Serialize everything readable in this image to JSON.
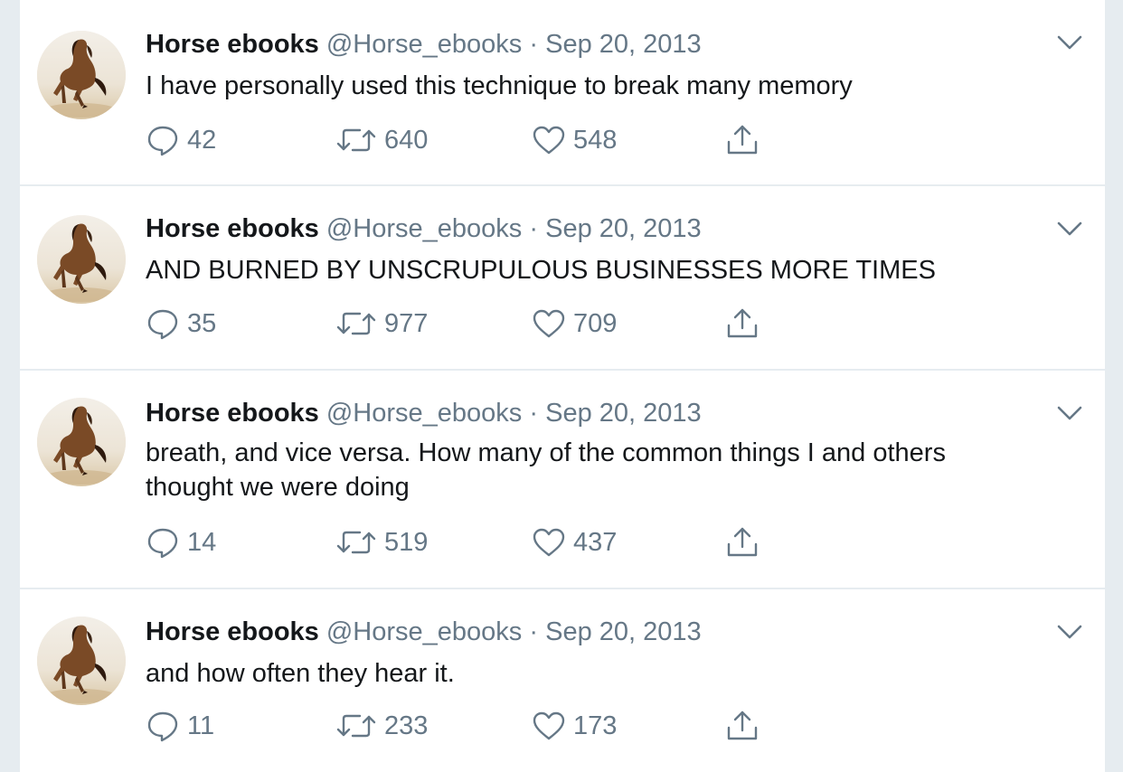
{
  "colors": {
    "page_background": "#e6ecf0",
    "card_background": "#ffffff",
    "primary_text": "#14171a",
    "secondary_text": "#657786"
  },
  "icons": {
    "reply": "speech-bubble-icon",
    "retweet": "retweet-arrows-icon",
    "like": "heart-icon",
    "share": "share-upload-icon",
    "menu": "chevron-down-icon"
  },
  "tweets": [
    {
      "display_name": "Horse ebooks",
      "handle": "@Horse_ebooks",
      "separator": "·",
      "date": "Sep 20, 2013",
      "text": "I have personally used this technique to break many memory",
      "replies": "42",
      "retweets": "640",
      "likes": "548"
    },
    {
      "display_name": "Horse ebooks",
      "handle": "@Horse_ebooks",
      "separator": "·",
      "date": "Sep 20, 2013",
      "text": "AND BURNED BY UNSCRUPULOUS BUSINESSES MORE TIMES",
      "replies": "35",
      "retweets": "977",
      "likes": "709"
    },
    {
      "display_name": "Horse ebooks",
      "handle": "@Horse_ebooks",
      "separator": "·",
      "date": "Sep 20, 2013",
      "text": "breath, and vice versa. How many of the common things I and others thought we were doing",
      "replies": "14",
      "retweets": "519",
      "likes": "437"
    },
    {
      "display_name": "Horse ebooks",
      "handle": "@Horse_ebooks",
      "separator": "·",
      "date": "Sep 20, 2013",
      "text": "and how often they hear it.",
      "replies": "11",
      "retweets": "233",
      "likes": "173"
    }
  ]
}
